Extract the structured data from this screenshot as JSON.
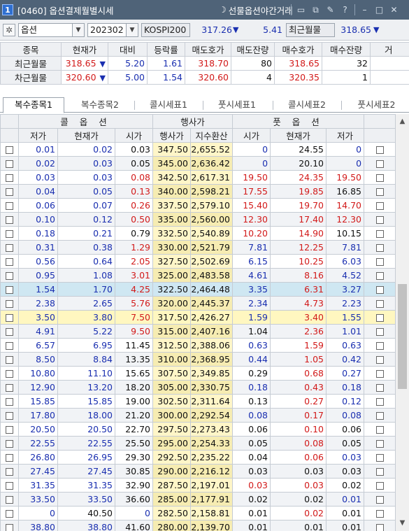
{
  "window": {
    "number": "1",
    "title": "[0460] 옵션결제월별시세",
    "night_trading": "선물옵션야간거래",
    "icons": [
      "window-icon",
      "copy-icon",
      "pin-icon",
      "help-icon",
      "minimize-icon",
      "maximize-icon",
      "close-icon"
    ]
  },
  "toolbar": {
    "market": "옵션",
    "month": "202302",
    "index_label": "KOSPI200",
    "index_value": "317.26",
    "index_change": "5.41",
    "nearest_label": "최근월물",
    "nearest_value": "318.65"
  },
  "futures": {
    "headers": [
      "종목",
      "현재가",
      "대비",
      "등락률",
      "매도호가",
      "매도잔량",
      "매수호가",
      "매수잔량",
      "거"
    ],
    "rows": [
      {
        "name": "최근월물",
        "price": "318.65",
        "change": "5.20",
        "rate": "1.61",
        "ask": "318.70",
        "ask_qty": "80",
        "bid": "318.65",
        "bid_qty": "32"
      },
      {
        "name": "차근월물",
        "price": "320.60",
        "change": "5.00",
        "rate": "1.54",
        "ask": "320.60",
        "ask_qty": "4",
        "bid": "320.35",
        "bid_qty": "1"
      }
    ]
  },
  "tabs": [
    "복수종목1",
    "복수종목2",
    "콜시세표1",
    "풋시세표1",
    "콜시세표2",
    "풋시세표2"
  ],
  "grid": {
    "group_headers": {
      "call": "콜 옵 션",
      "strike": "행사가",
      "put": "풋 옵 션"
    },
    "sub_headers": [
      "저가",
      "현재가",
      "시가",
      "행사가",
      "지수환산",
      "시가",
      "현재가",
      "저가"
    ],
    "rows": [
      {
        "c_low": "0.01",
        "c_cur": "0.02",
        "c_open": "0.03",
        "strike": "347.50",
        "idx": "2,655.52",
        "p_open": "0",
        "p_cur": "24.55",
        "p_low": "0"
      },
      {
        "c_low": "0.02",
        "c_cur": "0.03",
        "c_open": "0.05",
        "strike": "345.00",
        "idx": "2,636.42",
        "p_open": "0",
        "p_cur": "20.10",
        "p_low": "0"
      },
      {
        "c_low": "0.03",
        "c_cur": "0.03",
        "c_open": "0.08",
        "strike": "342.50",
        "idx": "2,617.31",
        "p_open": "19.50",
        "p_cur": "24.35",
        "p_low": "19.50"
      },
      {
        "c_low": "0.04",
        "c_cur": "0.05",
        "c_open": "0.13",
        "strike": "340.00",
        "idx": "2,598.21",
        "p_open": "17.55",
        "p_cur": "19.85",
        "p_low": "16.85"
      },
      {
        "c_low": "0.06",
        "c_cur": "0.07",
        "c_open": "0.26",
        "strike": "337.50",
        "idx": "2,579.10",
        "p_open": "15.40",
        "p_cur": "19.70",
        "p_low": "14.70"
      },
      {
        "c_low": "0.10",
        "c_cur": "0.12",
        "c_open": "0.50",
        "strike": "335.00",
        "idx": "2,560.00",
        "p_open": "12.30",
        "p_cur": "17.40",
        "p_low": "12.30"
      },
      {
        "c_low": "0.18",
        "c_cur": "0.21",
        "c_open": "0.79",
        "strike": "332.50",
        "idx": "2,540.89",
        "p_open": "10.20",
        "p_cur": "14.90",
        "p_low": "10.15"
      },
      {
        "c_low": "0.31",
        "c_cur": "0.38",
        "c_open": "1.29",
        "strike": "330.00",
        "idx": "2,521.79",
        "p_open": "7.81",
        "p_cur": "12.25",
        "p_low": "7.81"
      },
      {
        "c_low": "0.56",
        "c_cur": "0.64",
        "c_open": "2.05",
        "strike": "327.50",
        "idx": "2,502.69",
        "p_open": "6.15",
        "p_cur": "10.25",
        "p_low": "6.03"
      },
      {
        "c_low": "0.95",
        "c_cur": "1.08",
        "c_open": "3.01",
        "strike": "325.00",
        "idx": "2,483.58",
        "p_open": "4.61",
        "p_cur": "8.16",
        "p_low": "4.52"
      },
      {
        "c_low": "1.54",
        "c_cur": "1.70",
        "c_open": "4.25",
        "strike": "322.50",
        "idx": "2,464.48",
        "p_open": "3.35",
        "p_cur": "6.31",
        "p_low": "3.27"
      },
      {
        "c_low": "2.38",
        "c_cur": "2.65",
        "c_open": "5.76",
        "strike": "320.00",
        "idx": "2,445.37",
        "p_open": "2.34",
        "p_cur": "4.73",
        "p_low": "2.23"
      },
      {
        "c_low": "3.50",
        "c_cur": "3.80",
        "c_open": "7.50",
        "strike": "317.50",
        "idx": "2,426.27",
        "p_open": "1.59",
        "p_cur": "3.40",
        "p_low": "1.55"
      },
      {
        "c_low": "4.91",
        "c_cur": "5.22",
        "c_open": "9.50",
        "strike": "315.00",
        "idx": "2,407.16",
        "p_open": "1.04",
        "p_cur": "2.36",
        "p_low": "1.01"
      },
      {
        "c_low": "6.57",
        "c_cur": "6.95",
        "c_open": "11.45",
        "strike": "312.50",
        "idx": "2,388.06",
        "p_open": "0.63",
        "p_cur": "1.59",
        "p_low": "0.63"
      },
      {
        "c_low": "8.50",
        "c_cur": "8.84",
        "c_open": "13.35",
        "strike": "310.00",
        "idx": "2,368.95",
        "p_open": "0.44",
        "p_cur": "1.05",
        "p_low": "0.42"
      },
      {
        "c_low": "10.80",
        "c_cur": "11.10",
        "c_open": "15.65",
        "strike": "307.50",
        "idx": "2,349.85",
        "p_open": "0.29",
        "p_cur": "0.68",
        "p_low": "0.27"
      },
      {
        "c_low": "12.90",
        "c_cur": "13.20",
        "c_open": "18.20",
        "strike": "305.00",
        "idx": "2,330.75",
        "p_open": "0.18",
        "p_cur": "0.43",
        "p_low": "0.18"
      },
      {
        "c_low": "15.85",
        "c_cur": "15.85",
        "c_open": "19.00",
        "strike": "302.50",
        "idx": "2,311.64",
        "p_open": "0.13",
        "p_cur": "0.27",
        "p_low": "0.12"
      },
      {
        "c_low": "17.80",
        "c_cur": "18.00",
        "c_open": "21.20",
        "strike": "300.00",
        "idx": "2,292.54",
        "p_open": "0.08",
        "p_cur": "0.17",
        "p_low": "0.08"
      },
      {
        "c_low": "20.50",
        "c_cur": "20.50",
        "c_open": "22.70",
        "strike": "297.50",
        "idx": "2,273.43",
        "p_open": "0.06",
        "p_cur": "0.10",
        "p_low": "0.06"
      },
      {
        "c_low": "22.55",
        "c_cur": "22.55",
        "c_open": "25.50",
        "strike": "295.00",
        "idx": "2,254.33",
        "p_open": "0.05",
        "p_cur": "0.08",
        "p_low": "0.05"
      },
      {
        "c_low": "26.80",
        "c_cur": "26.95",
        "c_open": "29.30",
        "strike": "292.50",
        "idx": "2,235.22",
        "p_open": "0.04",
        "p_cur": "0.06",
        "p_low": "0.03"
      },
      {
        "c_low": "27.45",
        "c_cur": "27.45",
        "c_open": "30.85",
        "strike": "290.00",
        "idx": "2,216.12",
        "p_open": "0.03",
        "p_cur": "0.03",
        "p_low": "0.03"
      },
      {
        "c_low": "31.35",
        "c_cur": "31.35",
        "c_open": "32.90",
        "strike": "287.50",
        "idx": "2,197.01",
        "p_open": "0.03",
        "p_cur": "0.03",
        "p_low": "0.02"
      },
      {
        "c_low": "33.50",
        "c_cur": "33.50",
        "c_open": "36.60",
        "strike": "285.00",
        "idx": "2,177.91",
        "p_open": "0.02",
        "p_cur": "0.02",
        "p_low": "0.01"
      },
      {
        "c_low": "0",
        "c_cur": "40.50",
        "c_open": "0",
        "strike": "282.50",
        "idx": "2,158.81",
        "p_open": "0.01",
        "p_cur": "0.02",
        "p_low": "0.01"
      },
      {
        "c_low": "38.80",
        "c_cur": "38.80",
        "c_open": "41.60",
        "strike": "280.00",
        "idx": "2,139.70",
        "p_open": "0.01",
        "p_cur": "0.01",
        "p_low": "0.01"
      }
    ]
  },
  "colors": {
    "up": "#d21a1a",
    "down": "#1a2fb0",
    "title_bar": "#4f6378",
    "highlight_row": "#cfe7f2",
    "atm_row": "#fff7c0"
  }
}
